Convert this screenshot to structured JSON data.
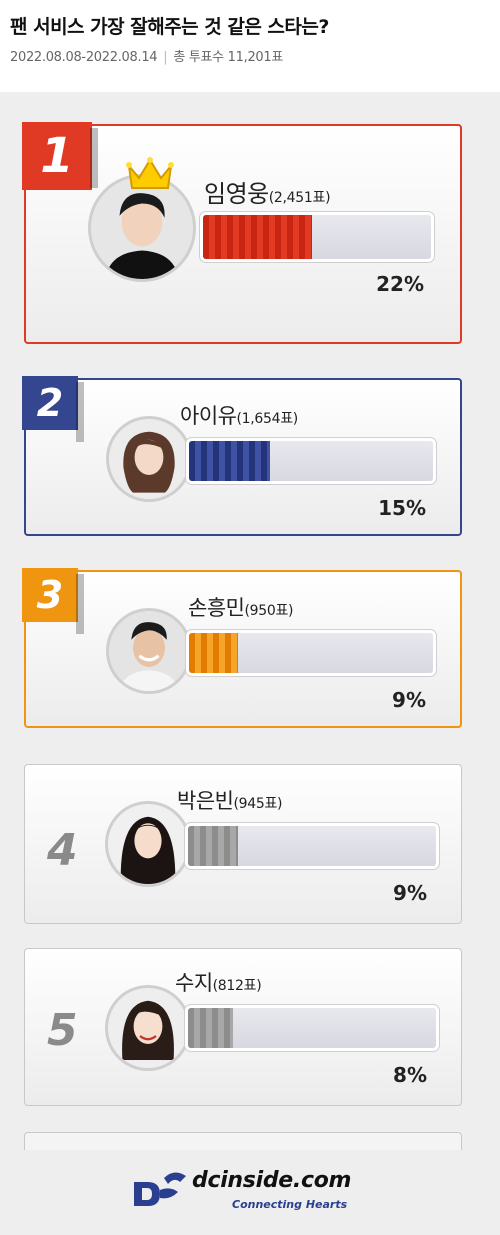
{
  "poll": {
    "title": "팬 서비스 가장 잘해주는 것 같은 스타는?",
    "period": "2022.08.08-2022.08.14",
    "total_label": "총 투표수 11,201표"
  },
  "candidates": [
    {
      "rank": "1",
      "name": "임영웅",
      "votes": "(2,451표)",
      "percent_label": "22%",
      "percent": 22,
      "color": "#e03a24"
    },
    {
      "rank": "2",
      "name": "아이유",
      "votes": "(1,654표)",
      "percent_label": "15%",
      "percent": 15,
      "color": "#34468f"
    },
    {
      "rank": "3",
      "name": "손흥민",
      "votes": "(950표)",
      "percent_label": "9%",
      "percent": 9,
      "color": "#f0950f"
    },
    {
      "rank": "4",
      "name": "박은빈",
      "votes": "(945표)",
      "percent_label": "9%",
      "percent": 9,
      "color": "#9a9a9a"
    },
    {
      "rank": "5",
      "name": "수지",
      "votes": "(812표)",
      "percent_label": "8%",
      "percent": 8,
      "color": "#9a9a9a"
    }
  ],
  "footer": {
    "brand": "dcinside.com",
    "tagline": "Connecting Hearts"
  }
}
